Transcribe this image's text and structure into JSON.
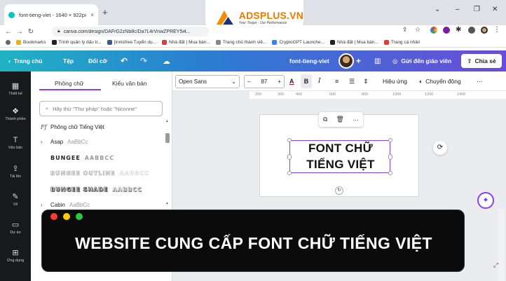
{
  "browser": {
    "tab_title": "font-tieng-viet - 1640 × 922px",
    "tab_close": "×",
    "new_tab": "+",
    "window_controls": [
      "⌄",
      "–",
      "❐",
      "✕"
    ],
    "url": "canva.com/design/DAFrG2zNb8c/Da7L4rVnwZPREY5i4...",
    "bookmarks": [
      {
        "label": "Bookmarks",
        "color": "#f2b400"
      },
      {
        "label": "Trình quản lý dấu tr...",
        "color": "#222"
      },
      {
        "label": "[innisfree Tuyển dụ...",
        "color": "#3b5998"
      },
      {
        "label": "Nhà đất | Mua bán...",
        "color": "#e53935"
      },
      {
        "label": "Trang chủ thành viê...",
        "color": "#888"
      },
      {
        "label": "CryptoGPT Launche...",
        "color": "#3b82f6"
      },
      {
        "label": "Nhà đất | Mua bán...",
        "color": "#222"
      },
      {
        "label": "Trang cá nhân",
        "color": "#e53935"
      }
    ]
  },
  "logo": {
    "name": "ADSPLUS.VN",
    "tagline": "Your Target - Our Performance",
    "color": "#e57c00"
  },
  "header": {
    "home": "Trang chủ",
    "file": "Tệp",
    "resize": "Đổi cỡ",
    "doc_name": "font-tieng-viet",
    "send": "Gửi đến giáo viên",
    "share": "Chia sẻ"
  },
  "rail": [
    {
      "label": "Thiết kế",
      "icon": "▦"
    },
    {
      "label": "Thành phần",
      "icon": "❖"
    },
    {
      "label": "Văn bản",
      "icon": "T"
    },
    {
      "label": "Tải lên",
      "icon": "⇪"
    },
    {
      "label": "Vẽ",
      "icon": "✎"
    },
    {
      "label": "Dự án",
      "icon": "▭"
    },
    {
      "label": "Ứng dụng",
      "icon": "⊞"
    }
  ],
  "panel": {
    "tab_fonts": "Phông chữ",
    "tab_styles": "Kiểu văn bản",
    "search_placeholder": "Hãy thử \"Thư pháp\" hoặc \"Niconne\"",
    "vietnamese_fonts": "Phông chữ Tiếng Việt",
    "fonts": [
      {
        "name": "Asap",
        "sample": "AaBbCc",
        "chevron": "›"
      },
      {
        "name": "BUNGEE",
        "sample": "AABBCC",
        "chevron": ""
      },
      {
        "name": "BUNGEE OUTLINE",
        "sample": "AABBCC",
        "chevron": ""
      },
      {
        "name": "BUNGEE SHADE",
        "sample": "AABBCC",
        "chevron": ""
      },
      {
        "name": "Cabin",
        "sample": "AaBbCc",
        "chevron": "›"
      }
    ]
  },
  "toolbar": {
    "font": "Open Sans",
    "size": "87",
    "minus": "–",
    "plus": "+",
    "bold": "B",
    "italic": "I",
    "effects": "Hiệu ứng",
    "animate": "Chuyển động",
    "more": "···"
  },
  "ruler": [
    "200",
    "300",
    "400",
    "600",
    "800",
    "1000",
    "1200",
    "1400"
  ],
  "canvas": {
    "line1": "FONT CHỮ",
    "line2": "TIẾNG VIỆT"
  },
  "banner": {
    "text": "WEBSITE CUNG CẤP FONT CHỮ TIẾNG VIỆT",
    "dots": [
      "#ff3b30",
      "#ffcc00",
      "#28c840"
    ]
  },
  "colors": {
    "accent": "#8b3dff",
    "header_start": "#1fb3c4",
    "header_end": "#6a4cdb"
  }
}
